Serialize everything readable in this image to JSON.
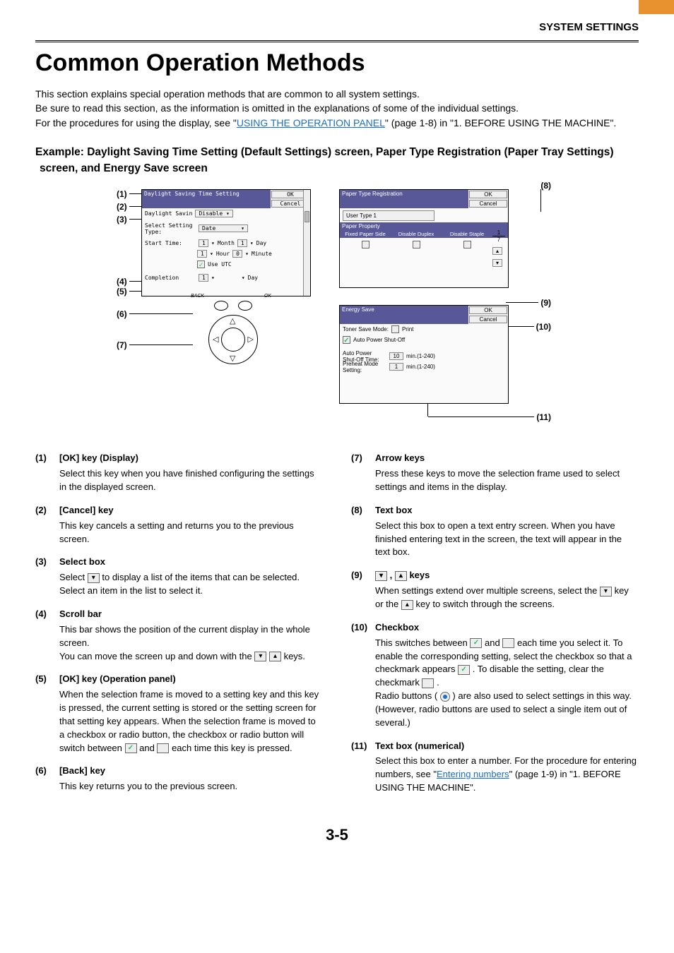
{
  "header": {
    "section": "SYSTEM SETTINGS"
  },
  "title": "Common Operation Methods",
  "intro": {
    "l1": "This section explains special operation methods that are common to all system settings.",
    "l2a": "Be sure to read this section, as the information is omitted in the explanations of some of the individual settings.",
    "l3a": "For the procedures for using the display, see \"",
    "l3link": "USING THE OPERATION PANEL",
    "l3b": "\" (page 1-8) in \"1. BEFORE USING THE MACHINE\"."
  },
  "example_heading": "Example: Daylight Saving Time Setting (Default Settings) screen, Paper Type Registration (Paper Tray Settings) screen, and Energy Save screen",
  "diagram_left": {
    "title": "Daylight Saving Time Setting",
    "ok": "OK",
    "cancel": "Cancel",
    "row1_label": "Daylight Savin",
    "row1_value": "Disable",
    "row2_label": "Select Setting Type:",
    "row2_value": "Date",
    "row3_label": "Start Time:",
    "row3_month": "Month",
    "row3_day": "Day",
    "row3_hour": "Hour",
    "row3_minute": "Minute",
    "row3_use_utc": "Use UTC",
    "row4_label": "Completion",
    "back_key": "BACK",
    "ok_key": "OK"
  },
  "diagram_right1": {
    "title": "Paper Type Registration",
    "ok": "OK",
    "cancel": "Cancel",
    "user_type": "User  Type  1",
    "prop_header": "Paper Property",
    "col_fixed": "Fixed Paper Side",
    "col_duplex": "Disable Duplex",
    "col_staple": "Disable Staple",
    "pg1": "1",
    "pg7": "7"
  },
  "diagram_right2": {
    "title": "Energy Save",
    "ok": "OK",
    "cancel": "Cancel",
    "toner": "Toner Save Mode:",
    "toner_print": "Print",
    "auto_off": "Auto Power Shut-Off",
    "auto_off_time_label": "Auto Power Shut-Off Time:",
    "auto_off_time_val": "10",
    "preheat_label": "Preheat Mode Setting:",
    "preheat_val": "1",
    "range": "min.(1-240)"
  },
  "callouts": {
    "c1": "(1)",
    "c2": "(2)",
    "c3": "(3)",
    "c4": "(4)",
    "c5": "(5)",
    "c6": "(6)",
    "c7": "(7)",
    "c8": "(8)",
    "c9": "(9)",
    "c10": "(10)",
    "c11": "(11)"
  },
  "items": {
    "i1": {
      "t": "[OK] key (Display)",
      "b": "Select this key when you have finished configuring the settings in the displayed screen."
    },
    "i2": {
      "t": "[Cancel] key",
      "b": "This key cancels a setting and returns you to the previous screen."
    },
    "i3": {
      "t": "Select box",
      "b1": "Select ",
      "b2": " to display a list of the items that can be selected. Select an item in the list to select it."
    },
    "i4": {
      "t": "Scroll bar",
      "b1": "This bar shows the position of the current display in the whole screen.",
      "b2a": "You can move the screen up and down with the ",
      "b2b": " keys."
    },
    "i5": {
      "t": "[OK] key (Operation panel)",
      "b1": "When the selection frame is moved to a setting key and this key is pressed, the current setting is stored or the setting screen for that setting key appears. When the selection frame is moved to a checkbox or radio button, the checkbox or radio button will switch between ",
      "b2": " and ",
      "b3": " each time this key is pressed."
    },
    "i6": {
      "t": "[Back] key",
      "b": "This key returns you to the previous screen."
    },
    "i7": {
      "t": "Arrow keys",
      "b": "Press these keys to move the selection frame used to select settings and items in the display."
    },
    "i8": {
      "t": "Text box",
      "b": "Select this box to open a text entry screen. When you have finished entering text in the screen, the text will appear in the text box."
    },
    "i9": {
      "t_sep": " , ",
      "t_suffix": " keys",
      "b1": "When settings extend over multiple screens, select the ",
      "b2": " key or the ",
      "b3": " key to switch through the screens."
    },
    "i10": {
      "t": "Checkbox",
      "b1": "This switches between ",
      "b2": " and ",
      "b3": " each time you select it. To enable the corresponding setting, select the checkbox so that a checkmark appears ",
      "b4": ". To disable the setting, clear the checkmark ",
      "b5": ".",
      "r1": "Radio buttons (",
      "r2": ") are also used to select settings in this way. (However, radio buttons are used to select a single item out of several.)"
    },
    "i11": {
      "t": "Text box (numerical)",
      "b1": "Select this box to enter a number. For the procedure for entering numbers, see \"",
      "link": "Entering numbers",
      "b2": "\" (page 1-9) in \"1. BEFORE USING THE MACHINE\"."
    }
  },
  "page_number": "3-5"
}
